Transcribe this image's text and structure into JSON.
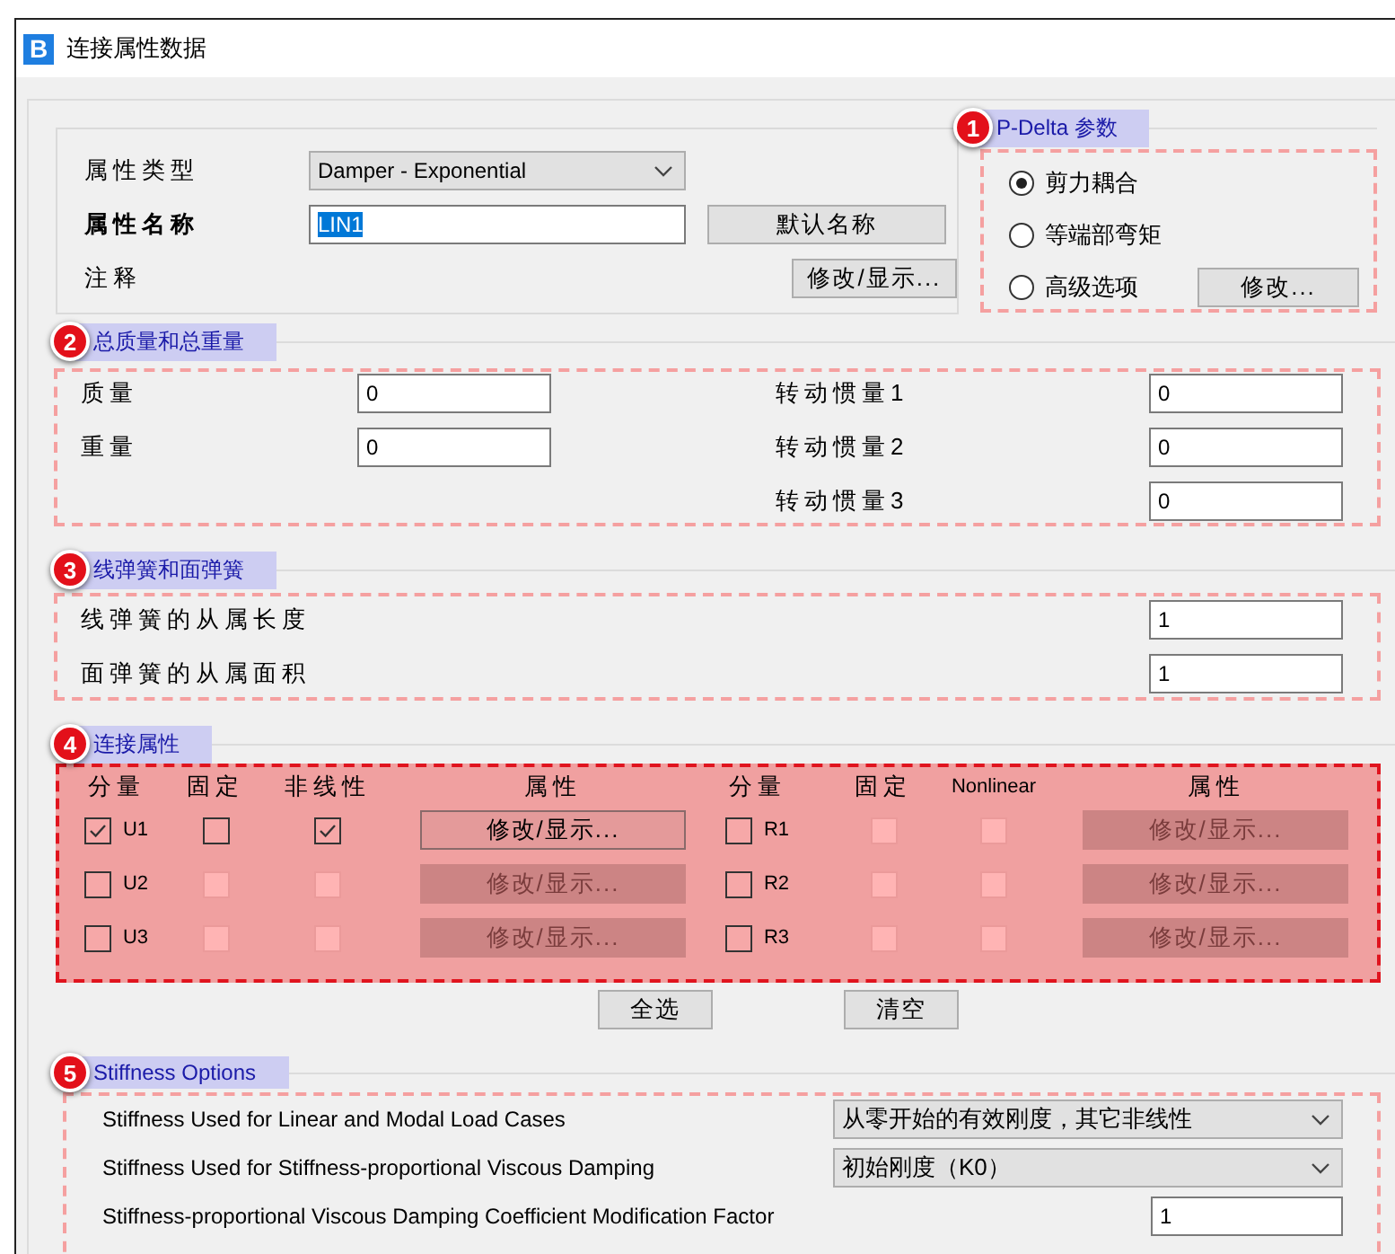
{
  "window": {
    "app_letter": "B",
    "title": "连接属性数据"
  },
  "general": {
    "type_label": "属性类型",
    "type_value": "Damper - Exponential",
    "name_label": "属性名称",
    "name_value": "LIN1",
    "name_value_selected": true,
    "default_name_button": "默认名称",
    "notes_label": "注释",
    "notes_button": "修改/显示..."
  },
  "p_delta": {
    "badge": "1",
    "title": "P-Delta 参数",
    "options": [
      {
        "label": "剪力耦合",
        "selected": true
      },
      {
        "label": "等端部弯矩",
        "selected": false
      },
      {
        "label": "高级选项",
        "selected": false
      }
    ],
    "modify_button": "修改..."
  },
  "mass_weight": {
    "badge": "2",
    "title": "总质量和总重量",
    "left_fields": [
      {
        "label": "质量",
        "value": "0"
      },
      {
        "label": "重量",
        "value": "0"
      }
    ],
    "right_fields": [
      {
        "label": "转动惯量1",
        "value": "0"
      },
      {
        "label": "转动惯量2",
        "value": "0"
      },
      {
        "label": "转动惯量3",
        "value": "0"
      }
    ]
  },
  "springs": {
    "badge": "3",
    "title": "线弹簧和面弹簧",
    "fields": [
      {
        "label": "线弹簧的从属长度",
        "value": "1"
      },
      {
        "label": "面弹簧的从属面积",
        "value": "1"
      }
    ]
  },
  "link_properties": {
    "badge": "4",
    "title": "连接属性",
    "groups": [
      {
        "headers": [
          "分量",
          "固定",
          "非线性",
          "属性"
        ],
        "rows": [
          {
            "name": "U1",
            "checked": true,
            "fixed": false,
            "nonlinear": true,
            "button": "修改/显示..."
          },
          {
            "name": "U2",
            "checked": false,
            "fixed": false,
            "nonlinear": false,
            "button": "修改/显示..."
          },
          {
            "name": "U3",
            "checked": false,
            "fixed": false,
            "nonlinear": false,
            "button": "修改/显示..."
          }
        ]
      },
      {
        "headers": [
          "分量",
          "固定",
          "Nonlinear",
          "属性"
        ],
        "rows": [
          {
            "name": "R1",
            "checked": false,
            "fixed": false,
            "nonlinear": false,
            "button": "修改/显示..."
          },
          {
            "name": "R2",
            "checked": false,
            "fixed": false,
            "nonlinear": false,
            "button": "修改/显示..."
          },
          {
            "name": "R3",
            "checked": false,
            "fixed": false,
            "nonlinear": false,
            "button": "修改/显示..."
          }
        ]
      }
    ],
    "buttons": [
      "全选",
      "清空"
    ]
  },
  "stiffness_options": {
    "badge": "5",
    "title": "Stiffness Options",
    "rows": [
      {
        "kind": "dropdown",
        "label": "Stiffness Used for Linear and Modal Load Cases",
        "value": "从零开始的有效刚度，其它非线性"
      },
      {
        "kind": "dropdown",
        "label": "Stiffness Used for Stiffness-proportional Viscous Damping",
        "value": "初始刚度（K0）"
      },
      {
        "kind": "input",
        "label": "Stiffness-proportional Viscous Damping Coefficient Modification Factor",
        "value": "1"
      }
    ]
  }
}
